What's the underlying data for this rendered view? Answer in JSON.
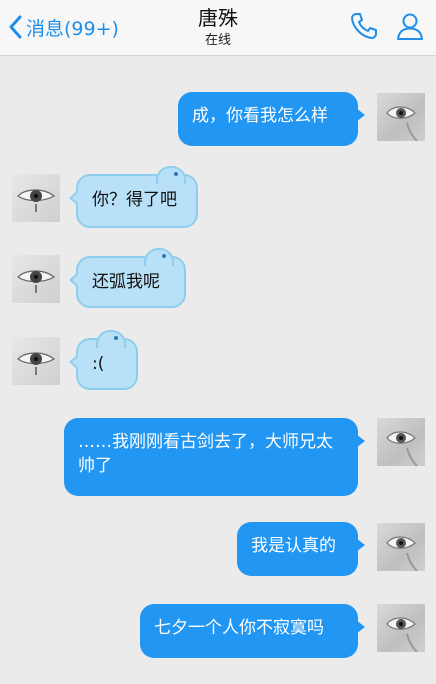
{
  "header": {
    "back_label": "消息(99+)",
    "contact_name": "唐殊",
    "status": "在线",
    "accent": "#1f8ee8"
  },
  "messages": [
    {
      "from": "me",
      "text": "成，你看我怎么样"
    },
    {
      "from": "other",
      "text": "你？得了吧"
    },
    {
      "from": "other",
      "text": "还弧我呢"
    },
    {
      "from": "other",
      "text": ":("
    },
    {
      "from": "me",
      "text": "……我刚刚看古剑去了，大师兄太帅了"
    },
    {
      "from": "me",
      "text": "我是认真的"
    },
    {
      "from": "me",
      "text": "七夕一个人你不寂寞吗"
    }
  ]
}
